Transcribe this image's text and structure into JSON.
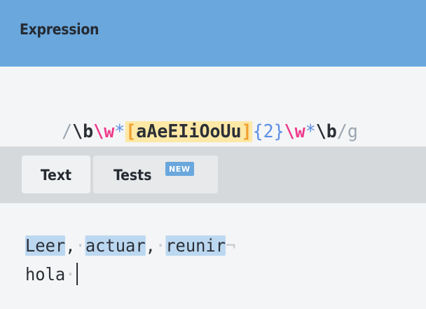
{
  "expression_panel": {
    "title": "Expression",
    "tokens": {
      "open_slash": "/",
      "boundary_1": "\\b",
      "word_class_1": "\\w",
      "star_1": "*",
      "bracket_open": "[",
      "char_set": "aAeEIiOoUu",
      "bracket_close": "]",
      "quantifier": "{2}",
      "word_class_2": "\\w",
      "star_2": "*",
      "boundary_2": "\\b",
      "close_slash": "/",
      "flag": "g"
    }
  },
  "tabs": {
    "text_label": "Text",
    "tests_label": "Tests",
    "new_badge": "NEW"
  },
  "editor": {
    "line1": {
      "word1": "Leer",
      "sep1": ",",
      "space1": "·",
      "word2": "actuar",
      "sep2": ",",
      "space2": "·",
      "word3": "reunir",
      "newline_mark": "¬"
    },
    "line2": {
      "word1": "hola",
      "space1": "·"
    }
  },
  "colors": {
    "header_bg": "#6aa7dc",
    "tab_bar_bg": "#d6d9dc",
    "match_highlight": "#bcd8f1",
    "char_set_highlight": "#fde8a6"
  }
}
